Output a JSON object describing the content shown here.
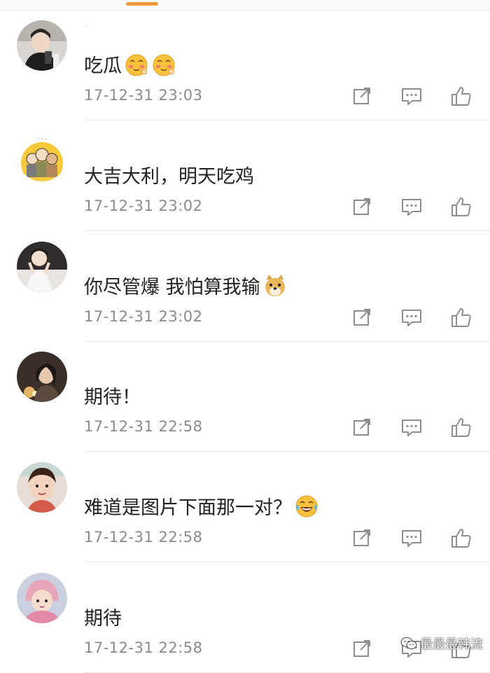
{
  "colors": {
    "accent": "#f29a3b",
    "time": "#8a8a8a",
    "icon": "#8e8e8e"
  },
  "comments": [
    {
      "username": "·",
      "text": "吃瓜",
      "emojis": [
        "blush-emoji",
        "blush-emoji"
      ],
      "time": "17-12-31 23:03"
    },
    {
      "username": "",
      "text": "大吉大利，明天吃鸡",
      "emojis": [],
      "time": "17-12-31 23:02"
    },
    {
      "username": "",
      "text": "你尽管爆 我怕算我输",
      "emojis": [
        "doge-emoji"
      ],
      "time": "17-12-31 23:02"
    },
    {
      "username": "",
      "text": "期待！",
      "emojis": [],
      "time": "17-12-31 22:58"
    },
    {
      "username": "",
      "text": "难道是图片下面那一对？",
      "emojis": [
        "laugh-cry-emoji"
      ],
      "time": "17-12-31 22:58"
    },
    {
      "username": "",
      "text": "期待",
      "emojis": [],
      "time": "17-12-31 22:58"
    }
  ],
  "watermark": {
    "text": "最最最韩流",
    "icon": "wechat-icon"
  }
}
